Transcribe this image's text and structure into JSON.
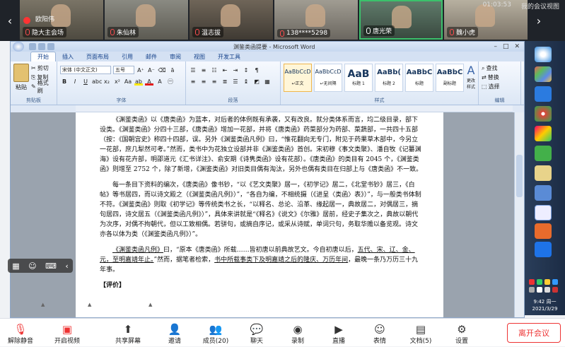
{
  "meeting": {
    "recording_user": "欧阳伟",
    "top_right_time": "01:03:53",
    "top_right_label": "我的会议视图",
    "participants": [
      {
        "name": "隐大主会场",
        "muted": true
      },
      {
        "name": "朱仙林",
        "muted": true
      },
      {
        "name": "温志拔",
        "muted": true
      },
      {
        "name": "138****5298",
        "muted": true
      },
      {
        "name": "唐光荣",
        "muted": false
      },
      {
        "name": "魏小虎",
        "muted": true
      }
    ],
    "toolbar": {
      "mute_label": "解除静音",
      "video_label": "开启视频",
      "share_label": "共享屏幕",
      "invite_label": "邀请",
      "members_label": "成员(20)",
      "chat_label": "聊天",
      "record_label": "录制",
      "live_label": "直播",
      "reaction_label": "表情",
      "docs_label": "文档(5)",
      "settings_label": "设置",
      "leave_label": "离开会议"
    }
  },
  "word": {
    "doc_title": "渊鉴类函提要 - Microsoft Word",
    "tabs": [
      "开始",
      "插入",
      "页面布局",
      "引用",
      "邮件",
      "审阅",
      "视图",
      "开发工具"
    ],
    "active_tab": "开始",
    "clipboard": {
      "paste": "粘贴",
      "cut": "剪切",
      "copy": "复制",
      "format_painter": "格式刷",
      "group": "剪贴板"
    },
    "font": {
      "name": "宋体 (中文正文)",
      "size": "五号",
      "group": "字体"
    },
    "paragraph_group": "段落",
    "styles": {
      "items": [
        {
          "sample": "AaBbCcD",
          "label": "↵正文"
        },
        {
          "sample": "AaBbCcD",
          "label": "↵无间隔"
        },
        {
          "sample": "AaB",
          "label": "标题 1"
        },
        {
          "sample": "AaBb(",
          "label": "标题 2"
        },
        {
          "sample": "AaBbC",
          "label": "标题"
        },
        {
          "sample": "AaBbC",
          "label": "副标题"
        }
      ],
      "change_styles": "更改样式",
      "group": "样式"
    },
    "editing": {
      "find": "查找",
      "replace": "替换",
      "select": "选择",
      "group": "编辑"
    }
  },
  "document": {
    "para1": "《渊鉴类函》以《唐类函》为蓝本，对后者的体例既有承袭，又有改良。就分类体系而言，均二级目录，部下设类。《渊鉴类函》分四十三部，《唐类函》增加一花部，并将《唐类函》药菜部分为药部、菜蔬部，一共四十五部（按：《国朝宫史》称四十四部，误。另外《渊鉴类函凡例》曰，“惟花翻向无专门，附见于药果草木部中，今另立一花部，庶几犁然可考。”然而，类书中为花独立设部并非《渊鉴类函》首创。宋初穆《事文类聚》、潘自牧《记纂渊海》设有花卉部，明邵道元《汇书详注》、俞安期《诗隽类函》设有花部）。《唐类函》的类目有 2045 个，《渊鉴类函》则增至 2752 个，除了新增，《渊鉴类函》对旧类目偶有淘汰，另外也偶有类目在归部上与《唐类函》不一致。",
    "para2": "每一条目下资料的编次，《唐类函》像书钞，“以《艺文类聚》居一，《初学记》居二，《北堂书钞》居三，《白帖》等书居四，而以诗文殿之（《渊鉴类函凡例》）”，“各自为编，不相统摄（《进呈〈类函〉表》）”，与一般类书体制不符。《渊鉴类函》则取《初学记》等传统类书之长，“以释名、总论、沿革、缘起居一，典故居二，对偶居三，摘句居四，诗文居五（《渊鉴类函凡例》）”，具体来讲就是“《释名》《说文》《尔雅》居前，经史子集次之，典故以朝代为次序，对偶不拘朝代，但以工致相偶。若骈句，或摘自序记，或采从诗赋，单词只句，务取华赡以备览观。诗文亦各以体为类（《渊鉴类函凡例》）”。",
    "para3_a": "《渊鉴类函凡例》",
    "para3_b": "曰，“原本《唐类函》所载……皆初唐以前典故艺文。今自初唐以后，",
    "para3_c": "五代、宋、辽、金、元，至明嘉靖年止。",
    "para3_d": "”然而，据笔者检索，",
    "para3_e": "书中所载事类下及明嘉靖之后的隆庆、万历年间",
    "para3_f": "，最晚一条乃万历三十九年事。",
    "next_heading": "【评价】"
  },
  "taskbar": {
    "clock_time": "9:42 周一",
    "clock_date": "2021/3/29"
  },
  "colors": {
    "accent_red": "#e33333",
    "strip_bg": "#1f2329",
    "ribbon_blue": "#15428b"
  }
}
